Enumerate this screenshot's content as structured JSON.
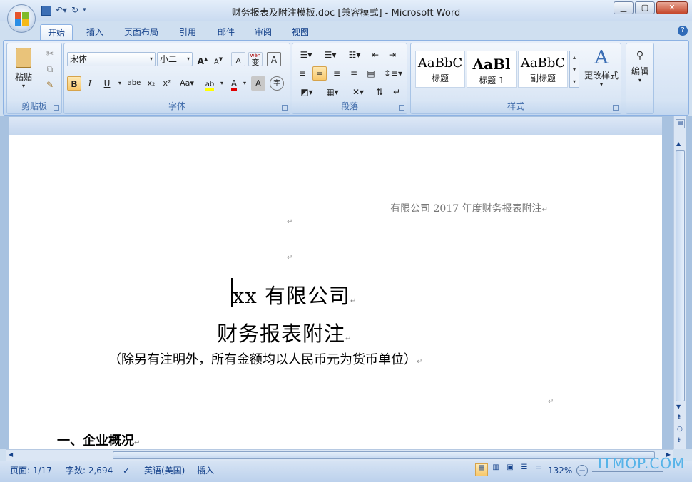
{
  "window": {
    "title": "财务报表及附注模板.doc [兼容模式] - Microsoft Word",
    "min": "▁",
    "max": "▢",
    "close": "✕"
  },
  "tabs": [
    "开始",
    "插入",
    "页面布局",
    "引用",
    "邮件",
    "审阅",
    "视图"
  ],
  "help": "?",
  "clipboard": {
    "paste": "粘贴",
    "group": "剪贴板"
  },
  "font": {
    "name": "宋体",
    "size": "小二",
    "group": "字体",
    "bold": "B",
    "italic": "I",
    "underline": "U",
    "strike": "abe",
    "sub": "x₂",
    "sup": "x²",
    "case": "Aa",
    "grow": "A",
    "shrink": "A",
    "clear": "A",
    "wen": "wén",
    "wenChar": "变",
    "border": "A",
    "highlight": "ab",
    "color": "A",
    "shade": "A",
    "enclose": "字"
  },
  "paragraph": {
    "group": "段落"
  },
  "styles": {
    "group": "样式",
    "items": [
      {
        "preview": "AaBbC",
        "name": "标题"
      },
      {
        "preview": "AaBl",
        "name": "标题 1"
      },
      {
        "preview": "AaBbC",
        "name": "副标题"
      }
    ],
    "change": "更改样式"
  },
  "edit": {
    "label": "编辑"
  },
  "document": {
    "header": "有限公司 2017 年度财务报表附注",
    "company": "xx 有限公司",
    "title": "财务报表附注",
    "subtitle": "（除另有注明外，所有金额均以人民币元为货币单位）",
    "section1": "一、企业概况",
    "ret": "↵"
  },
  "status": {
    "page": "页面: 1/17",
    "words": "字数: 2,694",
    "lang": "英语(美国)",
    "mode": "插入",
    "zoom": "132%"
  },
  "watermark": "ITMOP.COM",
  "colors": {
    "highlight": "#ffff00",
    "fontColor": "#e00000",
    "accent": "#15428b"
  }
}
